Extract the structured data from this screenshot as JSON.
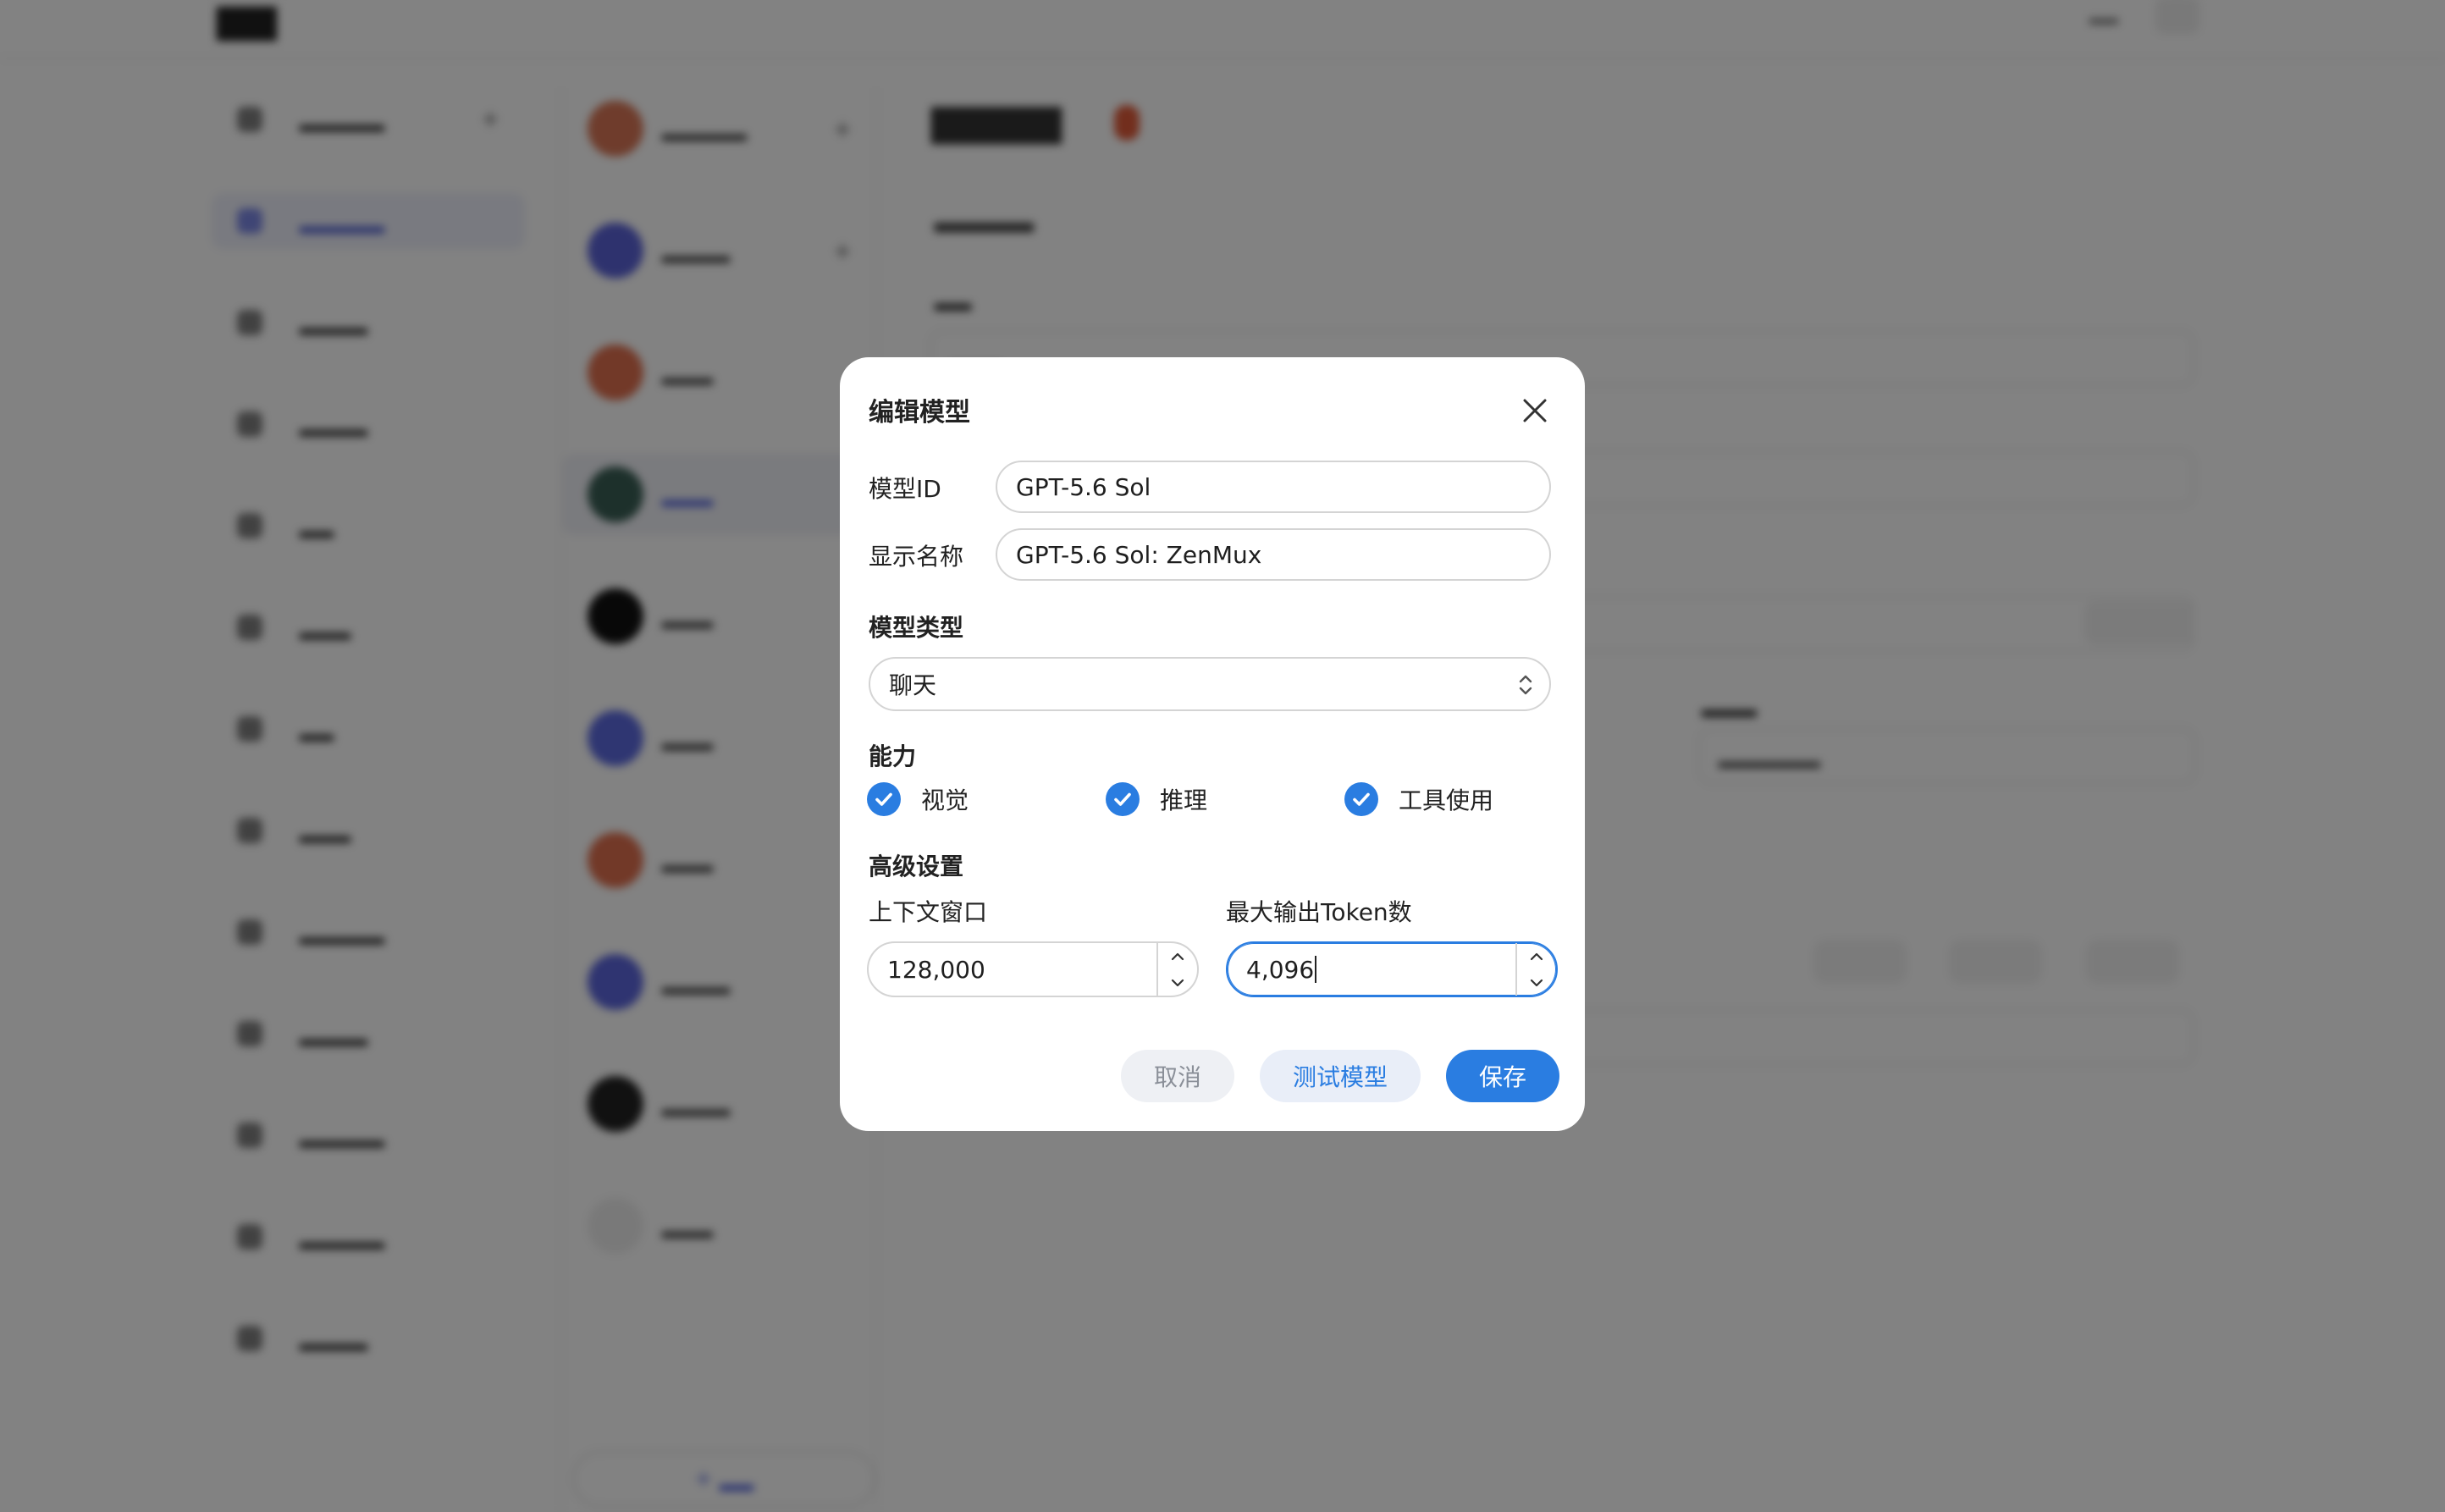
{
  "dialog": {
    "title": "编辑模型",
    "model_id_label": "模型ID",
    "model_id_value": "GPT-5.6 Sol",
    "display_name_label": "显示名称",
    "display_name_value": "GPT-5.6 Sol: ZenMux",
    "model_type_label": "模型类型",
    "model_type_value": "聊天",
    "capabilities_label": "能力",
    "capabilities": [
      {
        "label": "视觉",
        "checked": true
      },
      {
        "label": "推理",
        "checked": true
      },
      {
        "label": "工具使用",
        "checked": true
      }
    ],
    "advanced_label": "高级设置",
    "context_window_label": "上下文窗口",
    "context_window_value": "128,000",
    "max_output_label": "最大输出Token数",
    "max_output_value": "4,096",
    "cancel_label": "取消",
    "test_label": "测试模型",
    "save_label": "保存"
  },
  "colors": {
    "accent": "#2a7de1",
    "overlay": "rgba(0,0,0,0.49)"
  },
  "icons": {
    "close": "close-icon",
    "check": "check-icon",
    "select": "chevron-up-down-icon",
    "stepper_up": "chevron-up-icon",
    "stepper_down": "chevron-down-icon"
  }
}
